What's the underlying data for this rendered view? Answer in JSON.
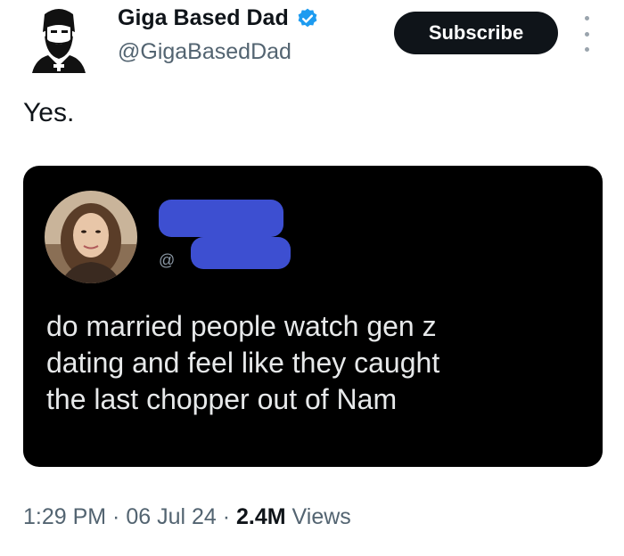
{
  "author": {
    "display_name": "Giga Based Dad",
    "handle": "@GigaBasedDad",
    "verified": true,
    "avatar_icon": "bearded-man-icon"
  },
  "subscribe_label": "Subscribe",
  "tweet": {
    "text": "Yes."
  },
  "quoted_post": {
    "handle_prefix": "@",
    "text": "do married people watch gen z\ndating and feel like they caught\nthe last chopper out of Nam",
    "redaction_color": "#3d4fd1"
  },
  "meta": {
    "time": "1:29 PM",
    "separator_1": " · ",
    "date": "06 Jul 24",
    "separator_2": " · ",
    "views_count": "2.4M",
    "views_label": " Views"
  },
  "colors": {
    "verified": "#1d9bf0",
    "subscribe_bg": "#0f1419",
    "card_bg": "#000000"
  }
}
